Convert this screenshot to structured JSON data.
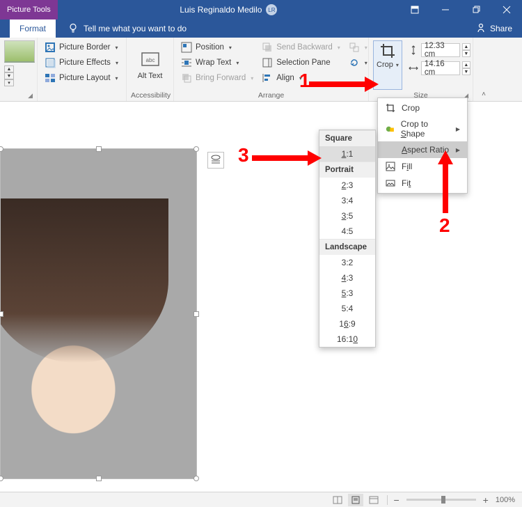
{
  "titlebar": {
    "contextual_tab": "Picture Tools",
    "doc_title": "Luis Reginaldo Medilo",
    "initials": "LR"
  },
  "tabrow": {
    "active_tab": "Format",
    "tellme_placeholder": "Tell me what you want to do",
    "share": "Share"
  },
  "ribbon": {
    "adjust": {
      "group_label": ""
    },
    "style": {
      "border": "Picture Border",
      "effects": "Picture Effects",
      "layout": "Picture Layout",
      "group_label": ""
    },
    "alttext": {
      "label": "Alt\nText",
      "group_label": "Accessibility"
    },
    "arrange": {
      "position": "Position",
      "wraptext": "Wrap Text",
      "bringfwd": "Bring Forward",
      "sendback": "Send Backward",
      "selpane": "Selection Pane",
      "align": "Align",
      "group_label": "Arrange"
    },
    "size": {
      "crop": "Crop",
      "height": "12.33 cm",
      "width": "14.16 cm",
      "group_label": "Size"
    }
  },
  "crop_menu": {
    "crop": "Crop",
    "crop_to_shape": "Crop to Shape",
    "aspect_ratio": "Aspect Ratio",
    "fill": "Fill",
    "fit": "Fit"
  },
  "ar_menu": {
    "square_head": "Square",
    "r1_1": "1:1",
    "portrait_head": "Portrait",
    "r2_3": "2:3",
    "r3_4": "3:4",
    "r3_5": "3:5",
    "r4_5": "4:5",
    "landscape_head": "Landscape",
    "r3_2": "3:2",
    "r4_3": "4:3",
    "r5_3": "5:3",
    "r5_4": "5:4",
    "r16_9": "16:9",
    "r16_10": "16:10"
  },
  "annotations": {
    "one": "1",
    "two": "2",
    "three": "3"
  },
  "statusbar": {
    "zoom_pct": "100%"
  }
}
